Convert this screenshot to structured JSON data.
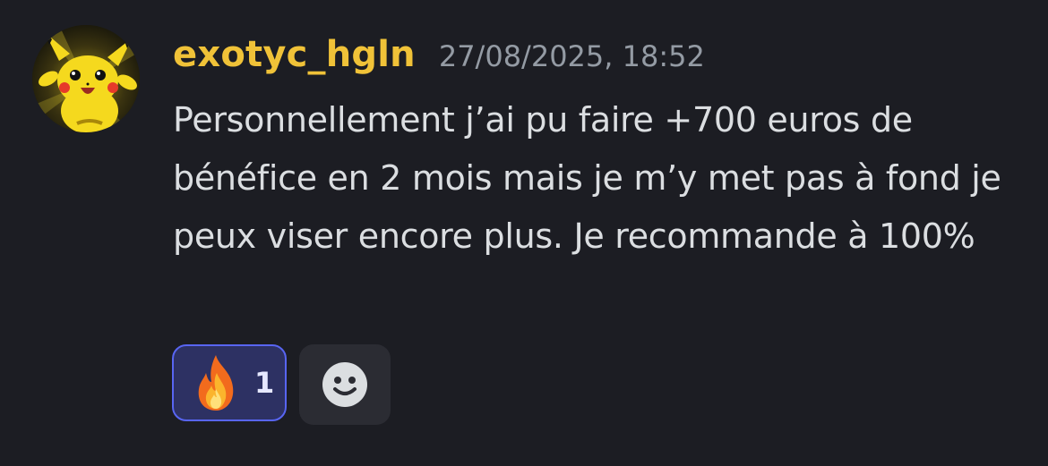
{
  "message": {
    "avatar_icon": "pikachu-avatar-icon",
    "username": "exotyc_hgln",
    "username_color": "#f0c238",
    "timestamp": "27/08/2025, 18:52",
    "content": "Personnellement j’ai pu faire +700 euros de bénéfice en 2 mois mais je m’y met pas à fond je peux viser encore plus. Je recommande à 100%"
  },
  "reactions": [
    {
      "emoji_icon": "fire-emoji-icon",
      "count": "1",
      "selected": true
    }
  ],
  "add_reaction_icon": "smiley-face-icon",
  "colors": {
    "background": "#1c1d23",
    "accent": "#5865f2",
    "reaction_selected_bg": "#2d3163",
    "text": "#dbdee1",
    "timestamp": "#949ba4"
  }
}
